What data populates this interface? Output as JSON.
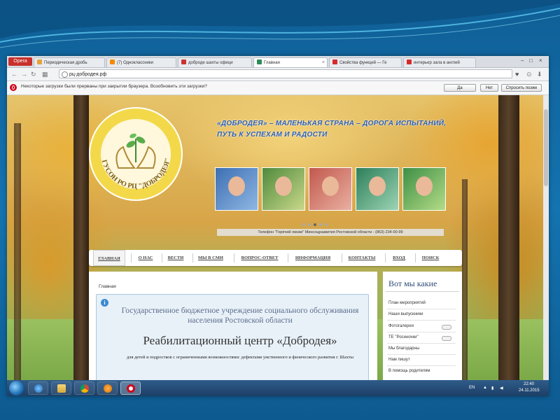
{
  "browser": {
    "menu_label": "Opera",
    "tabs": [
      {
        "label": "Периодическая дробь",
        "active": false,
        "icon_color": "#e6a23c"
      },
      {
        "label": "(7) Одноклассники",
        "active": false,
        "icon_color": "#f28b00"
      },
      {
        "label": "доброде шахты офици",
        "active": false,
        "icon_color": "#cc3333"
      },
      {
        "label": "Главная",
        "active": true,
        "icon_color": "#2e8b57"
      },
      {
        "label": "Свойства функций — Ге",
        "active": false,
        "icon_color": "#d62b2b"
      },
      {
        "label": "интерьер зала в англий",
        "active": false,
        "icon_color": "#d62b2b"
      }
    ],
    "url": "рц-добродея.рф",
    "notification": {
      "text": "Некоторые загрузки были прерваны при закрытии браузера. Возобновить эти загрузки?",
      "yes": "Да",
      "no": "Нет",
      "later": "Спросить позже"
    }
  },
  "site": {
    "logo_text": "ГУСОН РО РЦ \"ДОБРОДЕЯ\"",
    "slogan": "«ДОБРОДЕЯ» – МАЛЕНЬКАЯ СТРАНА – ДОРОГА ИСПЫТАНИЙ, ПУТЬ К УСПЕХАМ И РАДОСТИ",
    "phone": "Телефон \"Горячей линии\" Минсоцразвития Ростовской области - (863) 234-00-99",
    "menu": [
      "ГЛАВНАЯ",
      "О НАС",
      "ВЕСТИ",
      "МЫ В СМИ",
      "ВОПРОС-ОТВЕТ",
      "ИНФОРМАЦИЯ",
      "КОНТАКТЫ",
      "ВХОД",
      "ПОИСК"
    ],
    "breadcrumb": "Главная",
    "org_line1": "Государственное бюджетное учреждение социального обслуживания населения Ростовской области",
    "org_line2": "Реабилитационный центр «Добродея»",
    "org_line3": "для детей и подростков с ограниченными возможностями: дефектами умственного и физического развития г. Шахты",
    "sidebar_title": "Вот мы какие",
    "sidebar_items": [
      "План мероприятий",
      "Наши выпускники",
      "Фотогалерея",
      "ТЕ \"Росиночки\"",
      "Мы благодарны",
      "Нам пишут",
      "В помощь родителям"
    ]
  },
  "taskbar": {
    "lang": "EN",
    "time": "22:40",
    "date": "24.11.2015"
  }
}
